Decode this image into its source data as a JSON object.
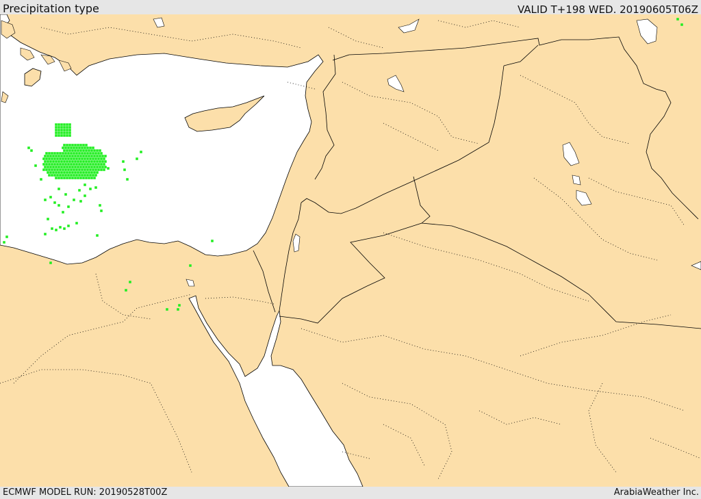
{
  "header": {
    "title": "Precipitation type",
    "valid": "VALID T+198 WED. 20190605T06Z"
  },
  "footer": {
    "model_run": "ECMWF MODEL RUN: 20190528T00Z",
    "credit": "ArabiaWeather Inc."
  },
  "colors": {
    "land": "#fcdfaa",
    "sea": "#ffffff",
    "precip": "#22ee22",
    "header_bg": "#e6e6e6"
  }
}
